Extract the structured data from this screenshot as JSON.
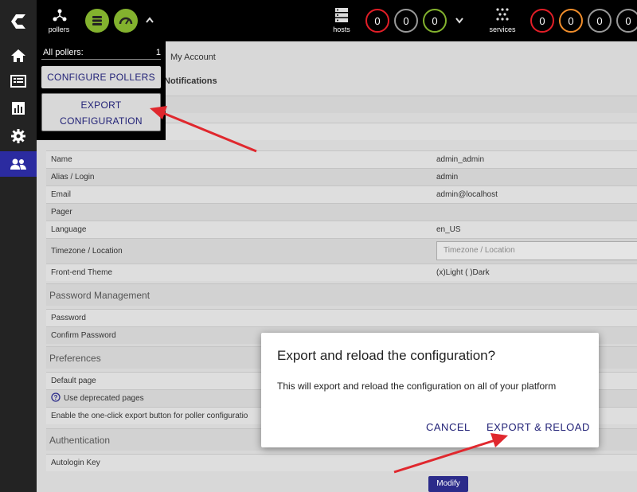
{
  "topbar": {
    "pollers_label": "pollers",
    "hosts_label": "hosts",
    "services_label": "services",
    "host_counters": [
      "0",
      "0",
      "0"
    ],
    "service_counters": [
      "0",
      "0",
      "0",
      "0"
    ]
  },
  "dropdown": {
    "header_label": "All pollers:",
    "header_count": "1",
    "configure_label": "CONFIGURE POLLERS",
    "export_line1": "EXPORT",
    "export_line2": "CONFIGURATION"
  },
  "page": {
    "breadcrumb": "My Account",
    "tab": "Notifications"
  },
  "form": {
    "name_label": "Name",
    "name_value": "admin_admin",
    "alias_label": "Alias / Login",
    "alias_value": "admin",
    "email_label": "Email",
    "email_value": "admin@localhost",
    "pager_label": "Pager",
    "language_label": "Language",
    "language_value": "en_US",
    "timezone_label": "Timezone / Location",
    "timezone_placeholder": "Timezone / Location",
    "theme_label": "Front-end Theme",
    "theme_value": "(x)Light ( )Dark",
    "password_section": "Password Management",
    "password_label": "Password",
    "confirm_label": "Confirm Password",
    "preferences_section": "Preferences",
    "default_page_label": "Default page",
    "deprecated_label": "Use deprecated pages",
    "oneclick_label": "Enable the one-click export button for poller configuratio",
    "auth_section": "Authentication",
    "autologin_label": "Autologin Key",
    "modify_label": "Modify"
  },
  "modal": {
    "title": "Export and reload the configuration?",
    "text": "This will export and reload the configuration on all of your platform",
    "cancel_label": "CANCEL",
    "export_label": "EXPORT & RELOAD"
  },
  "colors": {
    "accent": "#2b2ba0",
    "green": "#83b22e",
    "red": "#e21e27",
    "orange": "#f08d2b",
    "annotation": "#e0282e"
  }
}
